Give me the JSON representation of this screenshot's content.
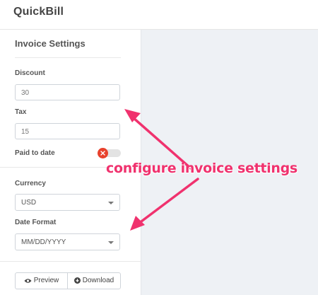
{
  "app": {
    "title": "QuickBill"
  },
  "settings": {
    "title": "Invoice Settings",
    "discount": {
      "label": "Discount",
      "value": "30"
    },
    "tax": {
      "label": "Tax",
      "value": "15"
    },
    "paid_to_date": {
      "label": "Paid to date",
      "toggle": "off"
    },
    "currency": {
      "label": "Currency",
      "selected": "USD"
    },
    "date_format": {
      "label": "Date Format",
      "selected": "MM/DD/YYYY"
    }
  },
  "actions": {
    "preview": "Preview",
    "download": "Download"
  },
  "annotation": {
    "text": "configure invoice settings",
    "color": "#f0326e"
  },
  "icons": {
    "eye": "eye-icon",
    "download": "download-circle-icon",
    "toggle_off": "close-icon"
  }
}
